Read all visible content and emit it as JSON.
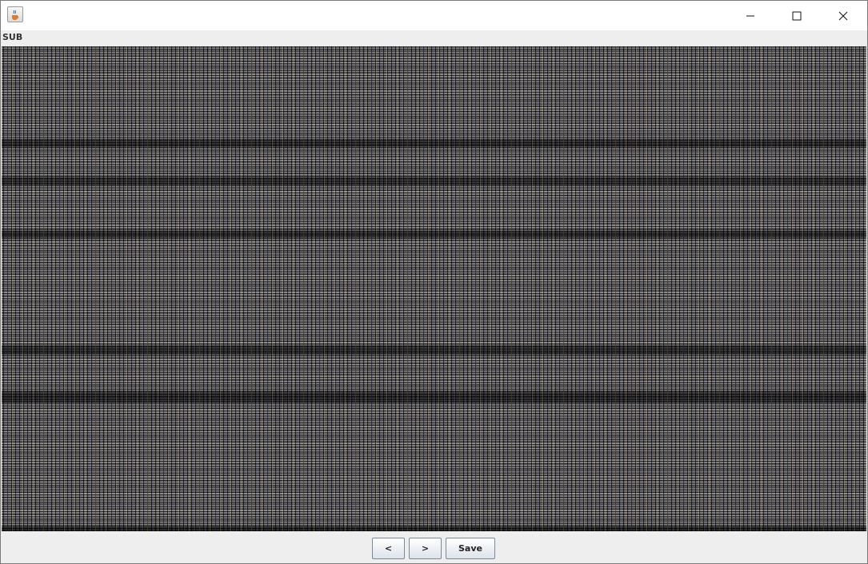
{
  "window": {
    "app_icon": "java-cup-icon",
    "controls": [
      "minimize-icon",
      "maximize-icon",
      "close-icon"
    ]
  },
  "header": {
    "label": "SUB"
  },
  "image_panel": {
    "content": "noise-image"
  },
  "toolbar": {
    "prev_label": "<",
    "next_label": ">",
    "save_label": "Save"
  }
}
